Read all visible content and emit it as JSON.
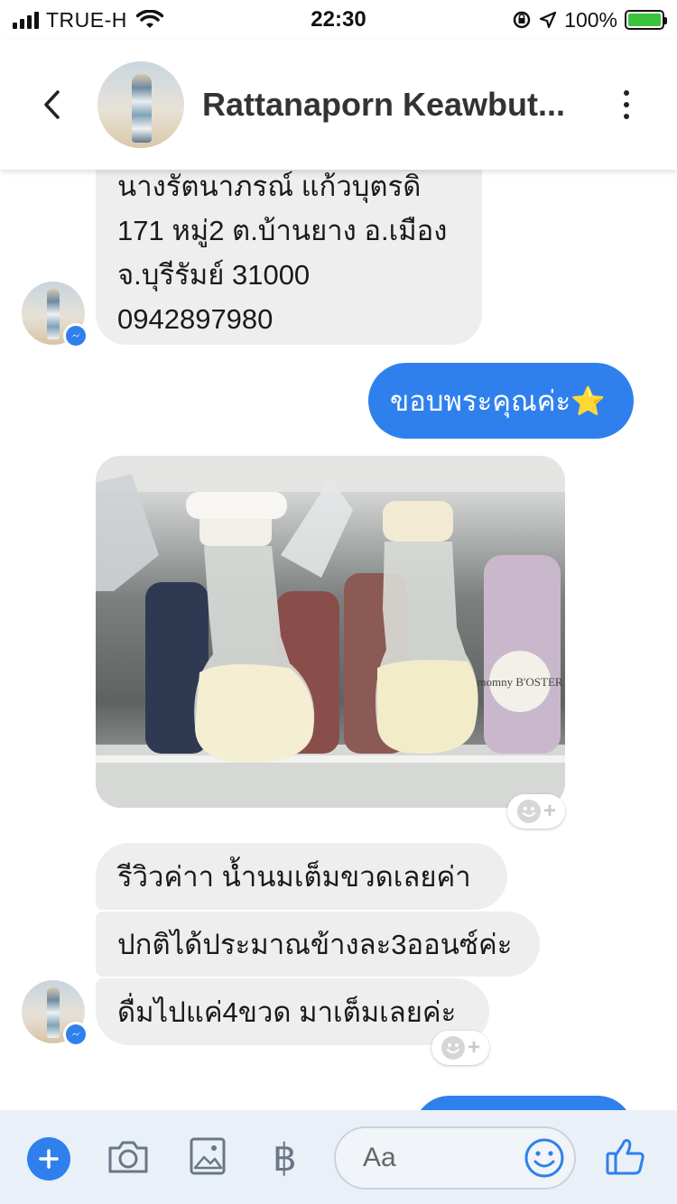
{
  "status_bar": {
    "carrier": "TRUE-H",
    "time": "22:30",
    "battery_percent": "100%",
    "battery_level": 1.0
  },
  "header": {
    "back_icon": "chevron-left-icon",
    "contact_name": "Rattanaporn Keawbut...",
    "more_icon": "vertical-ellipsis-icon"
  },
  "messages": {
    "address_lines": [
      "นางรัตนาภรณ์ แก้วบุตรดิ",
      "171 หมู่2 ต.บ้านยาง อ.เมือง",
      "จ.บุรีรัมย์  31000",
      "0942897980"
    ],
    "thanks": "ขอบพระคุณค่ะ⭐",
    "review_1": "รีวิวค่าา  น้ำนมเต็มขวดเลยค่า",
    "review_2": "ปกติได้ประมาณข้างละ3ออนซ์ค่ะ",
    "review_3": "ดื่มไปแค่4ขวด มาเต็มเลยค่ะ",
    "photo_label": "momny B'OSTER"
  },
  "composer": {
    "placeholder": "Aa",
    "currency_symbol": "฿"
  },
  "colors": {
    "accent": "#2f80ed",
    "incoming_bubble": "#eeeeee",
    "composer_bg": "#eaf0f8"
  }
}
